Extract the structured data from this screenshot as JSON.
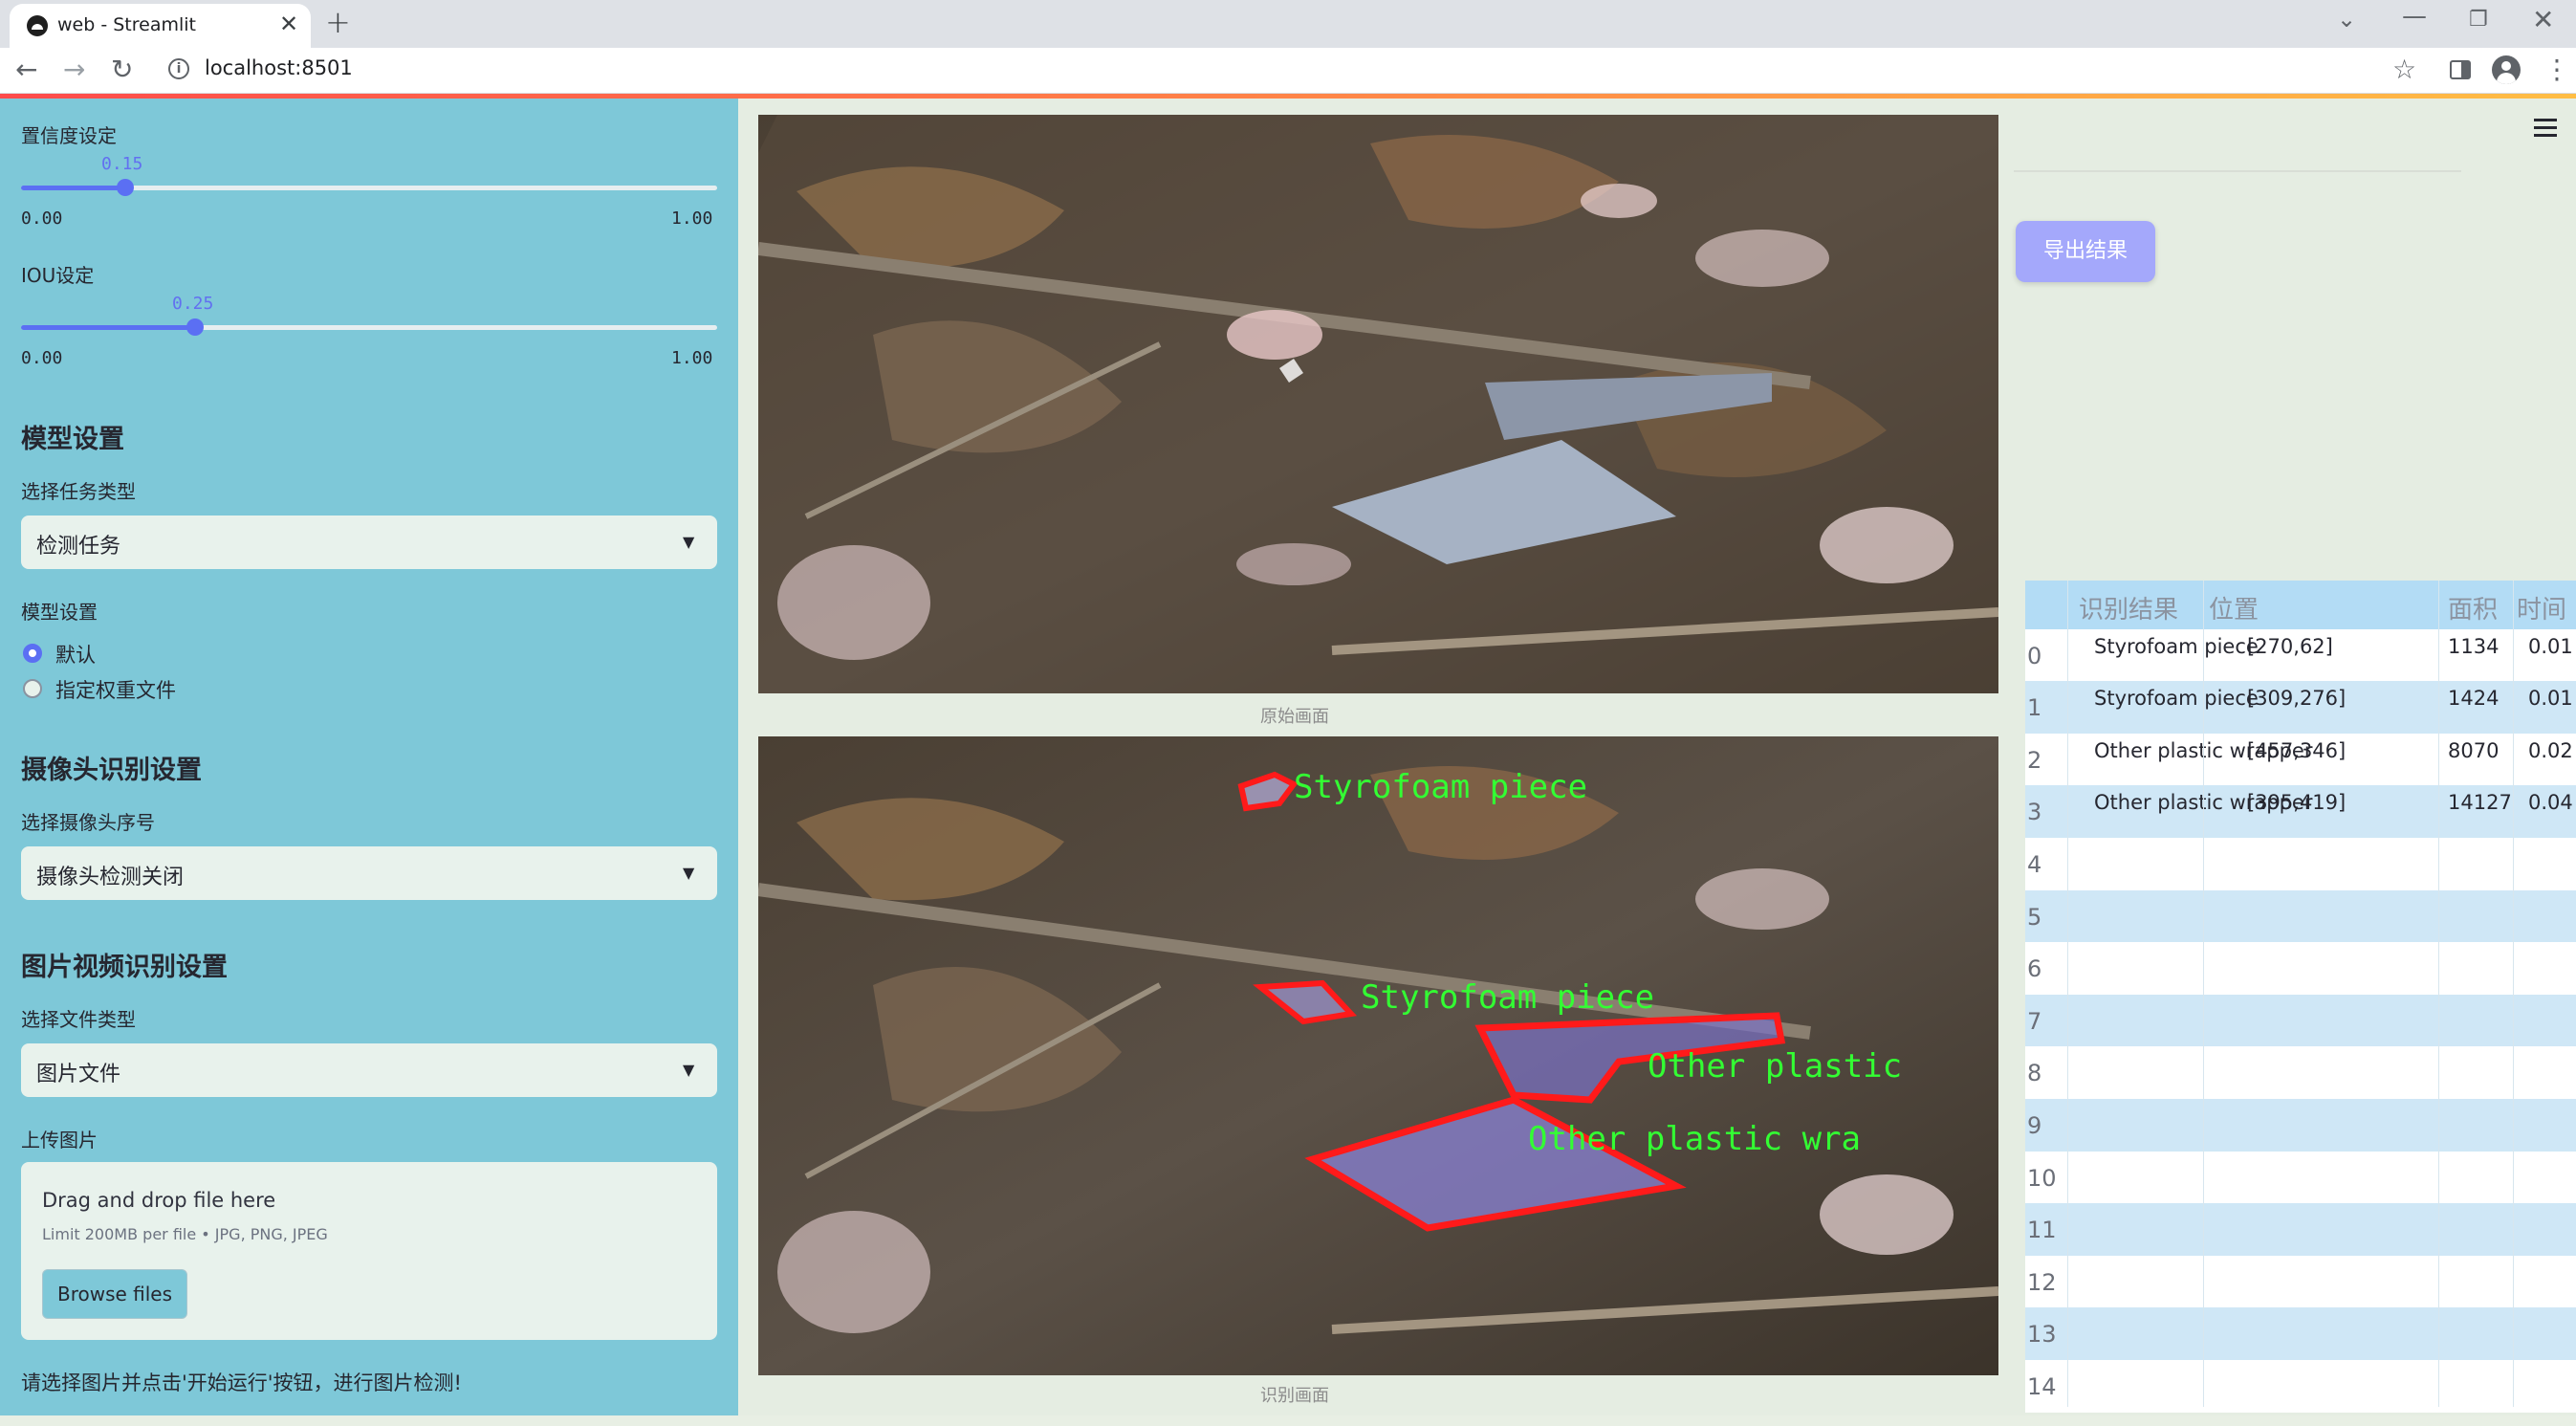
{
  "browser": {
    "tab_title": "web - Streamlit",
    "url": "localhost:8501",
    "tab_close": "✕",
    "new_tab": "+",
    "dropdown": "⌄",
    "minimize": "—",
    "restore": "❐",
    "close": "✕",
    "back": "←",
    "forward": "→",
    "reload": "↻",
    "star": "☆",
    "menu": "⋮"
  },
  "sidebar": {
    "confidence": {
      "label": "置信度设定",
      "value": "0.15",
      "fraction": 0.15,
      "min": "0.00",
      "max": "1.00"
    },
    "iou": {
      "label": "IOU设定",
      "value": "0.25",
      "fraction": 0.25,
      "min": "0.00",
      "max": "1.00"
    },
    "model_header": "模型设置",
    "task_label": "选择任务类型",
    "task_value": "检测任务",
    "model_label": "模型设置",
    "radio_default": "默认",
    "radio_custom": "指定权重文件",
    "camera_header": "摄像头识别设置",
    "camera_label": "选择摄像头序号",
    "camera_value": "摄像头检测关闭",
    "media_header": "图片视频识别设置",
    "file_type_label": "选择文件类型",
    "file_type_value": "图片文件",
    "upload_label": "上传图片",
    "drop_text": "Drag and drop file here",
    "drop_limit": "Limit 200MB per file • JPG, PNG, JPEG",
    "browse": "Browse files",
    "hint": "请选择图片并点击'开始运行'按钮，进行图片检测!"
  },
  "main": {
    "original_caption": "原始画面",
    "result_caption": "识别画面",
    "export_button": "导出结果",
    "detections": [
      {
        "label": "Styrofoam piece"
      },
      {
        "label": "Styrofoam piece"
      },
      {
        "label": "Other plastic"
      },
      {
        "label": "Other plastic wra"
      }
    ]
  },
  "table": {
    "headers": [
      "识别结果",
      "位置",
      "面积",
      "时间"
    ],
    "rows": [
      {
        "idx": "0",
        "result": "Styrofoam piece",
        "pos": "[270,62]",
        "area": "1134",
        "time": "0.01"
      },
      {
        "idx": "1",
        "result": "Styrofoam piece",
        "pos": "[309,276]",
        "area": "1424",
        "time": "0.01"
      },
      {
        "idx": "2",
        "result": "Other plastic wrapper",
        "pos": "[457,346]",
        "area": "8070",
        "time": "0.02"
      },
      {
        "idx": "3",
        "result": "Other plastic wrapper",
        "pos": "[395,419]",
        "area": "14127",
        "time": "0.04"
      },
      {
        "idx": "4",
        "result": "",
        "pos": "",
        "area": "",
        "time": ""
      },
      {
        "idx": "5",
        "result": "",
        "pos": "",
        "area": "",
        "time": ""
      },
      {
        "idx": "6",
        "result": "",
        "pos": "",
        "area": "",
        "time": ""
      },
      {
        "idx": "7",
        "result": "",
        "pos": "",
        "area": "",
        "time": ""
      },
      {
        "idx": "8",
        "result": "",
        "pos": "",
        "area": "",
        "time": ""
      },
      {
        "idx": "9",
        "result": "",
        "pos": "",
        "area": "",
        "time": ""
      },
      {
        "idx": "10",
        "result": "",
        "pos": "",
        "area": "",
        "time": ""
      },
      {
        "idx": "11",
        "result": "",
        "pos": "",
        "area": "",
        "time": ""
      },
      {
        "idx": "12",
        "result": "",
        "pos": "",
        "area": "",
        "time": ""
      },
      {
        "idx": "13",
        "result": "",
        "pos": "",
        "area": "",
        "time": ""
      },
      {
        "idx": "14",
        "result": "",
        "pos": "",
        "area": "",
        "time": ""
      }
    ]
  },
  "colors": {
    "sidebar_bg": "#7ec8d8",
    "accent": "#5b6ff3",
    "detect_outline": "#ff1a1a",
    "detect_text": "#33ff33",
    "table_header": "#b3dcf5",
    "row_even": "#ffffff",
    "row_odd": "#cfe7f6"
  }
}
